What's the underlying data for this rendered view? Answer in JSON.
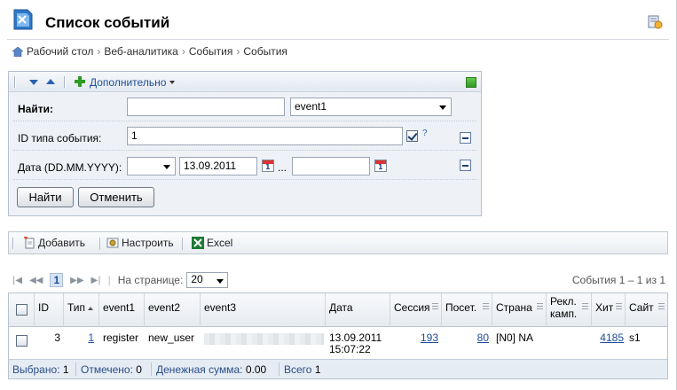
{
  "page": {
    "title": "Список событий",
    "breadcrumbs": [
      "Рабочий стол",
      "Веб-аналитика",
      "События",
      "События"
    ]
  },
  "filter": {
    "more_label": "Дополнительно",
    "find_label": "Найти:",
    "find_value": "",
    "find_field_value": "event1",
    "event_type_label": "ID типа события:",
    "event_type_value": "1",
    "event_type_checked": true,
    "help_mark": "?",
    "date_label": "Дата (DD.MM.YYYY):",
    "date_mode_value": "",
    "date_from": "13.09.2011",
    "date_sep": "...",
    "date_to": "",
    "find_button": "Найти",
    "cancel_button": "Отменить"
  },
  "toolbar": {
    "add_label": "Добавить",
    "settings_label": "Настроить",
    "excel_label": "Excel"
  },
  "pager": {
    "current_page": "1",
    "per_page_label": "На странице:",
    "per_page_value": "20",
    "counter": "События 1 – 1 из 1"
  },
  "grid": {
    "columns": [
      "ID",
      "Тип",
      "event1",
      "event2",
      "event3",
      "Дата",
      "Сессия",
      "Посет.",
      "Страна",
      "Рекл. камп.",
      "Хит",
      "Сайт"
    ],
    "rows": [
      {
        "id": "3",
        "type": "1",
        "event1": "register",
        "event2": "new_user",
        "event3": "",
        "date_line1": "13.09.2011",
        "date_line2": "15:07:22",
        "session": "193",
        "guest": "80",
        "country": "[N0] NA",
        "campaign": "",
        "hit": "4185",
        "site": "s1"
      }
    ],
    "footer": {
      "selected_label": "Выбрано:",
      "selected_value": "1",
      "checked_label": "Отмечено:",
      "checked_value": "0",
      "money_label": "Денежная сумма:",
      "money_value": "0.00",
      "total_label": "Всего",
      "total_value": "1"
    }
  },
  "colors": {
    "link": "#1c4c9c",
    "panel_bg": "#eef2f7",
    "accent_green": "#2f9a22"
  },
  "icons": [
    "app-logo-icon",
    "bookmark-icon",
    "home-icon",
    "collapse-icon",
    "expand-icon",
    "plus-icon",
    "add-doc-icon",
    "settings-icon",
    "excel-icon",
    "calendar-icon",
    "first-page-icon",
    "prev-page-icon",
    "next-page-icon",
    "last-page-icon"
  ]
}
